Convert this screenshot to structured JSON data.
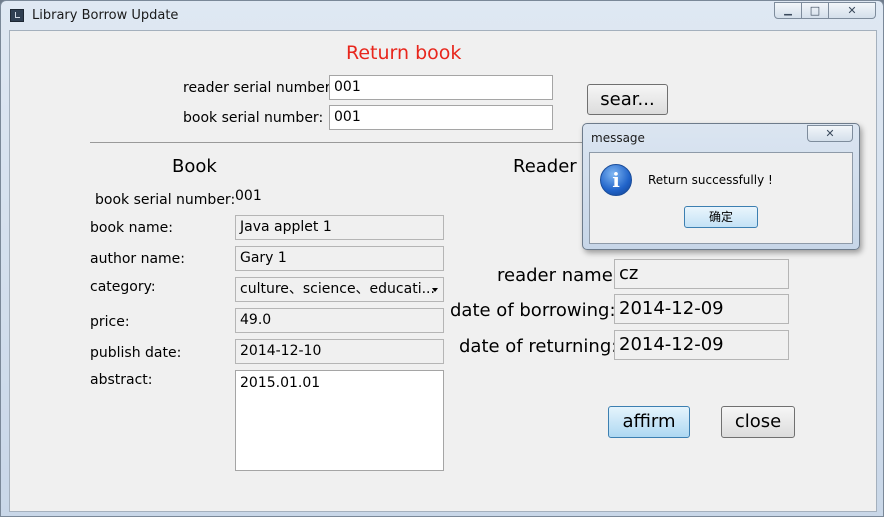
{
  "window": {
    "title": "Library Borrow Update"
  },
  "form": {
    "heading": "Return book",
    "reader_serial_label": "reader serial number:",
    "reader_serial_value": "001",
    "book_serial_label": "book serial number:",
    "book_serial_value": "001",
    "search_button": "sear..."
  },
  "book": {
    "heading": "Book",
    "serial_label": "book serial number:",
    "serial_value": "001",
    "name_label": "book name:",
    "name_value": "Java applet 1",
    "author_label": "author name:",
    "author_value": "Gary 1",
    "category_label": "category:",
    "category_value": "culture、science、educati...",
    "price_label": "price:",
    "price_value": "49.0",
    "publish_label": "publish date:",
    "publish_value": "2014-12-10",
    "abstract_label": "abstract:",
    "abstract_value": "2015.01.01"
  },
  "reader": {
    "heading": "Reader",
    "name_label": "reader name:",
    "name_value": "cz",
    "borrow_label": "date of borrowing:",
    "borrow_value": "2014-12-09",
    "return_label": "date of returning:",
    "return_value": "2014-12-09"
  },
  "actions": {
    "affirm": "affirm",
    "close": "close"
  },
  "dialog": {
    "title": "message",
    "message": "Return successfully !",
    "ok_button": "确定",
    "icon": "info-icon"
  },
  "colors": {
    "heading": "#e8261c",
    "window_frame": "#c9d7e8",
    "focus_button": "#aed8f2"
  }
}
